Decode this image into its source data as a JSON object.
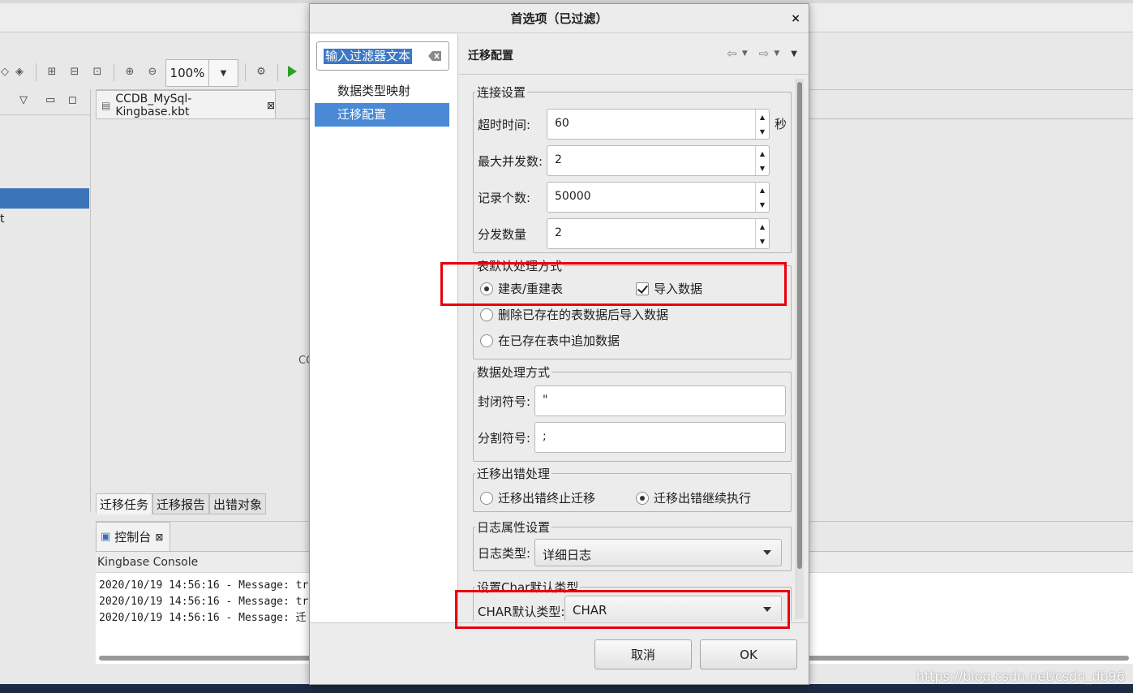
{
  "ide": {
    "zoom": "100%",
    "left_panel_fragment": "t",
    "editor_tab": "CCDB_MySql-Kingbase.kbt",
    "editor_fragment": "CC",
    "sub_tabs": [
      "迁移任务",
      "迁移报告",
      "出错对象"
    ],
    "console_tab": "控制台",
    "console_title": "Kingbase Console",
    "console_lines": [
      "2020/10/19 14:56:16 - Message: tr",
      "2020/10/19 14:56:16 - Message: tr",
      "2020/10/19 14:56:16 - Message: 迁"
    ]
  },
  "dialog": {
    "title": "首选项（已过滤）",
    "close": "×",
    "filter_text": "输入过滤器文本",
    "nav_items": [
      "数据类型映射",
      "迁移配置"
    ],
    "content_title": "迁移配置",
    "connection": {
      "legend": "连接设置",
      "timeout_label": "超时时间:",
      "timeout_value": "60",
      "timeout_unit": "秒",
      "max_concurrency_label": "最大并发数:",
      "max_concurrency_value": "2",
      "record_count_label": "记录个数:",
      "record_count_value": "50000",
      "dispatch_count_label": "分发数量",
      "dispatch_count_value": "2"
    },
    "table_default": {
      "legend": "表默认处理方式",
      "create_rebuild": "建表/重建表",
      "import_data": "导入数据",
      "delete_then_import": "删除已存在的表数据后导入数据",
      "append_existing": "在已存在表中追加数据"
    },
    "data_processing": {
      "legend": "数据处理方式",
      "enclose_label": "封闭符号:",
      "enclose_value": "\"",
      "separator_label": "分割符号:",
      "separator_value": ";"
    },
    "error_handling": {
      "legend": "迁移出错处理",
      "stop": "迁移出错终止迁移",
      "continue": "迁移出错继续执行"
    },
    "log": {
      "legend": "日志属性设置",
      "type_label": "日志类型:",
      "type_value": "详细日志"
    },
    "char_type": {
      "legend": "设置Char默认类型",
      "label": "CHAR默认类型:",
      "value": "CHAR"
    },
    "cancel": "取消",
    "ok": "OK"
  },
  "watermark": "https://blog.csdn.net/csdn_db96",
  "colors": {
    "highlight": "#e8000b",
    "selection": "#4a89d6"
  }
}
